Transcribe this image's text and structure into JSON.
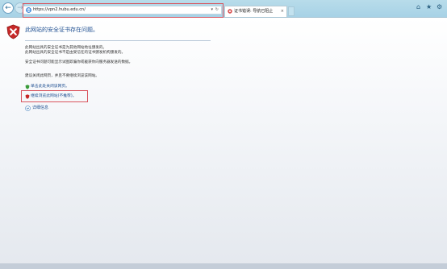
{
  "browser": {
    "address_url": "https://vpn2.hubu.edu.cn/",
    "address_action1": "▾",
    "address_action2": "↻",
    "tab_title": "证书错误: 导航已阻止",
    "tab_close": "×",
    "tools": {
      "home": "⌂",
      "favorites": "★",
      "settings": "⚙"
    }
  },
  "page": {
    "title": "此网站的安全证书存在问题。",
    "lines": [
      "此网站出具的安全证书是为其他网站地址颁发的。",
      "此网站出具的安全证书不是由受信任的证书颁发机构颁发的。",
      "安全证书问题可能显示试图欺骗你或截获你向服务器发送的数据。",
      "建议关闭此网页，并且不要继续浏览该网站。"
    ],
    "links": {
      "close_page": "单击此处关闭该网页。",
      "continue": "继续浏览此网站(不推荐)。"
    },
    "more_info": "详细信息"
  },
  "colors": {
    "link": "#1f4f91",
    "annotation": "#d9545e",
    "chrome": "#a7d2e6"
  }
}
